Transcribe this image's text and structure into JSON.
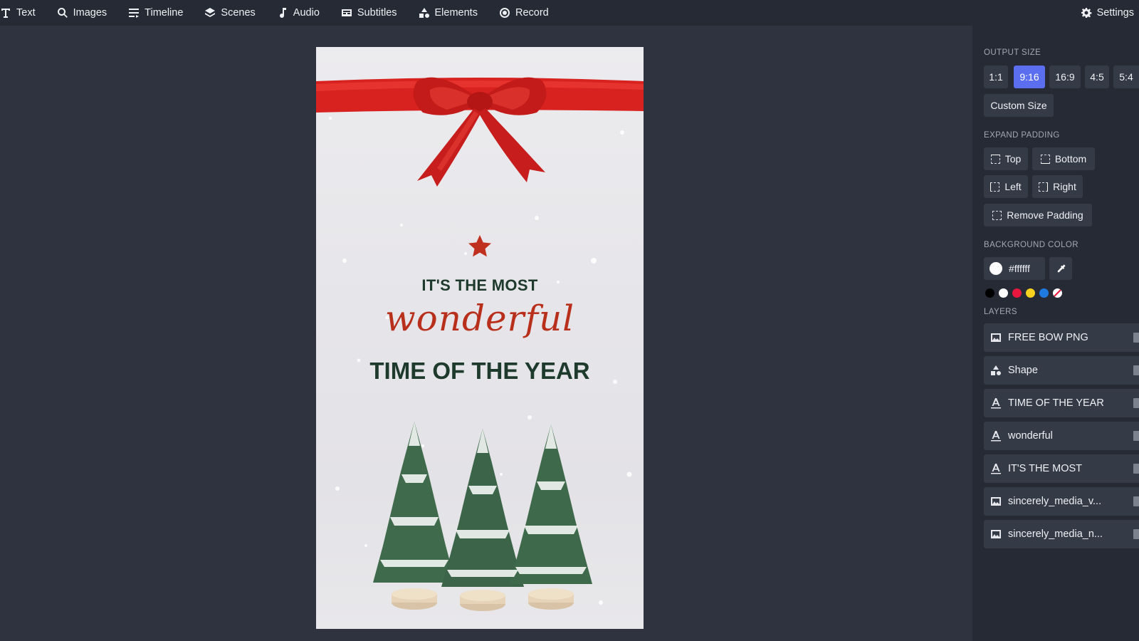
{
  "toolbar": {
    "items": [
      {
        "label": "Text",
        "icon": "text-icon"
      },
      {
        "label": "Images",
        "icon": "search-icon"
      },
      {
        "label": "Timeline",
        "icon": "timeline-icon"
      },
      {
        "label": "Scenes",
        "icon": "layers-icon"
      },
      {
        "label": "Audio",
        "icon": "music-note-icon"
      },
      {
        "label": "Subtitles",
        "icon": "subtitles-icon"
      },
      {
        "label": "Elements",
        "icon": "shapes-icon"
      },
      {
        "label": "Record",
        "icon": "record-icon"
      }
    ],
    "settings_label": "Settings"
  },
  "canvas": {
    "line1": "IT'S THE MOST",
    "line2": "wonderful",
    "line3": "TIME OF THE YEAR",
    "colors": {
      "dark_green": "#1e3a2c",
      "red": "#b8301c"
    }
  },
  "panel": {
    "output_size": {
      "title": "OUTPUT SIZE",
      "options": [
        "1:1",
        "9:16",
        "16:9",
        "4:5",
        "5:4"
      ],
      "selected": "9:16",
      "custom": "Custom Size"
    },
    "padding": {
      "title": "EXPAND PADDING",
      "top": "Top",
      "bottom": "Bottom",
      "left": "Left",
      "right": "Right",
      "remove": "Remove Padding"
    },
    "background": {
      "title": "BACKGROUND COLOR",
      "value": "#ffffff",
      "swatches": [
        "#000000",
        "#ffffff",
        "#e8173e",
        "#f7d320",
        "#1f7ae0",
        "none"
      ]
    },
    "layers": {
      "title": "LAYERS",
      "items": [
        {
          "label": "FREE BOW PNG",
          "icon": "image-icon"
        },
        {
          "label": "Shape",
          "icon": "shapes-icon"
        },
        {
          "label": "TIME OF THE YEAR",
          "icon": "text-layer-icon"
        },
        {
          "label": "wonderful",
          "icon": "text-layer-icon"
        },
        {
          "label": "IT'S THE MOST",
          "icon": "text-layer-icon"
        },
        {
          "label": "sincerely_media_v...",
          "icon": "image-icon"
        },
        {
          "label": "sincerely_media_n...",
          "icon": "image-icon"
        }
      ]
    }
  }
}
